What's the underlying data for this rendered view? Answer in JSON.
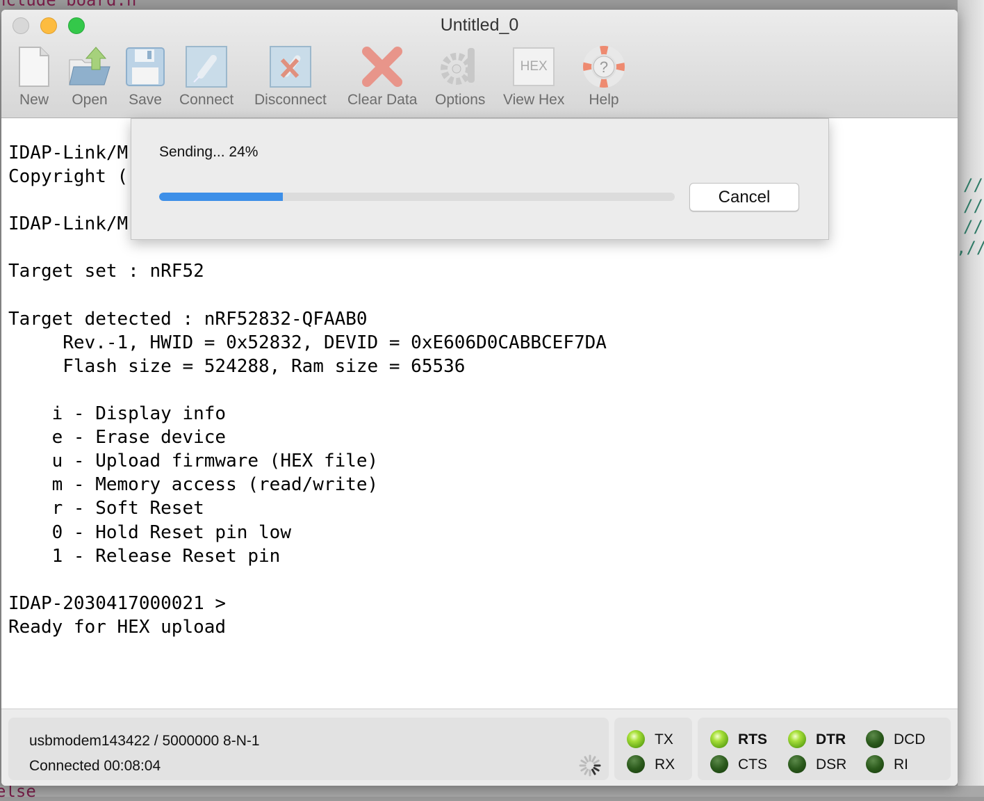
{
  "background": {
    "top_code": "nclude  board.h",
    "bottom_code": "else",
    "right_code": [
      "//",
      "//",
      "//",
      ",//"
    ]
  },
  "window": {
    "title": "Untitled_0"
  },
  "toolbar": [
    {
      "label": "New",
      "icon": "new-document-icon"
    },
    {
      "label": "Open",
      "icon": "open-folder-icon"
    },
    {
      "label": "Save",
      "icon": "floppy-disk-icon"
    },
    {
      "label": "Connect",
      "icon": "plug-icon"
    },
    {
      "label": "Disconnect",
      "icon": "unplug-icon"
    },
    {
      "label": "Clear Data",
      "icon": "red-x-icon"
    },
    {
      "label": "Options",
      "icon": "gear-wrench-icon"
    },
    {
      "label": "View Hex",
      "icon": "hex-icon",
      "icon_text": "HEX"
    },
    {
      "label": "Help",
      "icon": "lifebuoy-help-icon"
    }
  ],
  "terminal": {
    "lines": [
      "IDAP-Link/M",
      "Copyright (",
      "",
      "IDAP-Link/M",
      "",
      "Target set : nRF52",
      "",
      "Target detected : nRF52832-QFAAB0",
      "     Rev.-1, HWID = 0x52832, DEVID = 0xE606D0CABBCEF7DA",
      "     Flash size = 524288, Ram size = 65536",
      "",
      "    i - Display info",
      "    e - Erase device",
      "    u - Upload firmware (HEX file)",
      "    m - Memory access (read/write)",
      "    r - Soft Reset",
      "    0 - Hold Reset pin low",
      "    1 - Release Reset pin",
      "",
      "IDAP-2030417000021 >",
      "Ready for HEX upload"
    ]
  },
  "dialog": {
    "status": "Sending...  24%",
    "progress_percent": 24,
    "cancel_label": "Cancel",
    "progress_color": "#3d8fe8"
  },
  "status": {
    "port": "usbmodem143422 / 5000000 8-N-1",
    "connection": "Connected 00:08:04",
    "leds": [
      {
        "label": "TX",
        "on": true
      },
      {
        "label": "RX",
        "on": false
      },
      {
        "label": "RTS",
        "on": true
      },
      {
        "label": "CTS",
        "on": false
      },
      {
        "label": "DTR",
        "on": true
      },
      {
        "label": "DSR",
        "on": false
      },
      {
        "label": "DCD",
        "on": false
      },
      {
        "label": "RI",
        "on": false
      }
    ]
  }
}
